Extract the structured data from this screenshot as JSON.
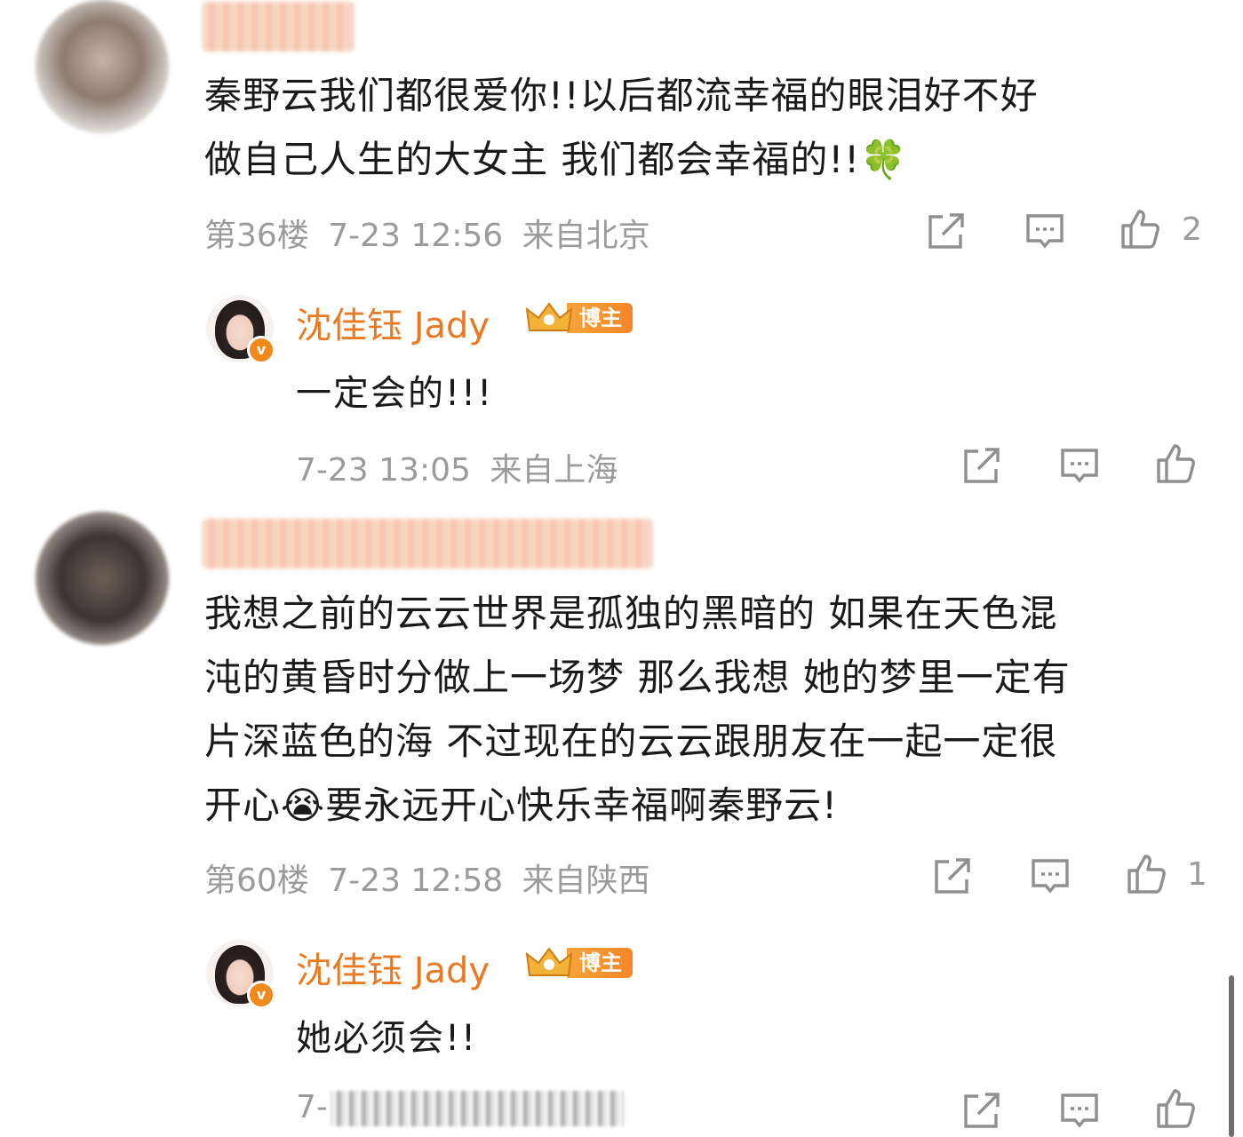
{
  "comments": [
    {
      "text_line1": "秦野云我们都很爱你!!以后都流幸福的眼泪好不好",
      "text_line2": "做自己人生的大女主 我们都会幸福的!!",
      "emoji": "🍀",
      "floor": "第36楼",
      "time": "7-23 12:56",
      "location": "来自北京",
      "like_count": "2",
      "reply": {
        "name": "沈佳钰 Jady",
        "badge_label": "博主",
        "verified_mark": "v",
        "text": "一定会的!!!",
        "time": "7-23 13:05",
        "location": "来自上海"
      }
    },
    {
      "text_line1": "我想之前的云云世界是孤独的黑暗的 如果在天色混",
      "text_line2": "沌的黄昏时分做上一场梦 那么我想 她的梦里一定有",
      "text_line3": "片深蓝色的海 不过现在的云云跟朋友在一起一定很",
      "text_line4a": "开心",
      "emoji": "😭",
      "text_line4b": "要永远开心快乐幸福啊秦野云!",
      "floor": "第60楼",
      "time": "7-23 12:58",
      "location": "来自陕西",
      "like_count": "1",
      "reply": {
        "name": "沈佳钰 Jady",
        "badge_label": "博主",
        "verified_mark": "v",
        "text": "她必须会!!",
        "time_prefix": "7-"
      }
    }
  ],
  "icons": {
    "share": "share-icon",
    "comment": "comment-icon",
    "like": "thumbs-up-icon"
  },
  "colors": {
    "reply_name": "#e97a24",
    "meta": "#9b9b9b",
    "badge": "#f3862a"
  }
}
